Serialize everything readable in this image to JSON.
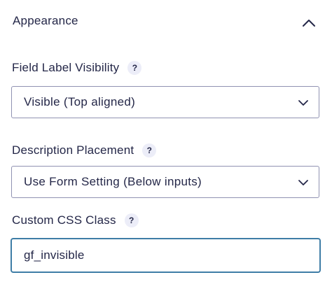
{
  "section": {
    "title": "Appearance",
    "toggle_icon": "chevron-up-icon"
  },
  "fields": {
    "label_visibility": {
      "label": "Field Label Visibility",
      "help": "?",
      "value": "Visible (Top aligned)",
      "chevron_icon": "chevron-down-icon"
    },
    "description_placement": {
      "label": "Description Placement",
      "help": "?",
      "value": "Use Form Setting (Below inputs)",
      "chevron_icon": "chevron-down-icon"
    },
    "css_class": {
      "label": "Custom CSS Class",
      "help": "?",
      "value": "gf_invisible"
    }
  },
  "colors": {
    "text": "#242748",
    "border": "#9092b2",
    "focus_border": "#3e7da6",
    "help_badge_bg": "#ecedf8"
  }
}
